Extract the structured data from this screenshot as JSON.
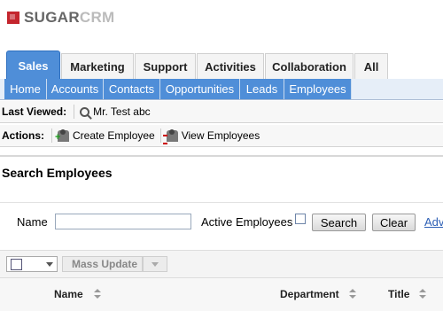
{
  "brand": {
    "name_a": "SUGAR",
    "name_b": "CRM"
  },
  "module_tabs": [
    "Sales",
    "Marketing",
    "Support",
    "Activities",
    "Collaboration",
    "All"
  ],
  "sub_tabs": [
    "Home",
    "Accounts",
    "Contacts",
    "Opportunities",
    "Leads",
    "Employees"
  ],
  "last_viewed": {
    "label": "Last Viewed:",
    "item": "Mr. Test abc",
    "icon": "search-icon"
  },
  "actions": {
    "label": "Actions:",
    "create": "Create Employee",
    "view": "View Employees"
  },
  "page_title": "Search Employees",
  "search": {
    "name_label": "Name",
    "name_value": "",
    "active_label": "Active Employees",
    "search_button": "Search",
    "clear_button": "Clear",
    "advanced_link": "Adv"
  },
  "list": {
    "mass_update": "Mass Update",
    "columns": [
      "Name",
      "Department",
      "Title"
    ]
  },
  "colors": {
    "tab_active": "#4f8ed8",
    "subtab_bg": "#4f8ed8",
    "link": "#2d5fb5"
  }
}
